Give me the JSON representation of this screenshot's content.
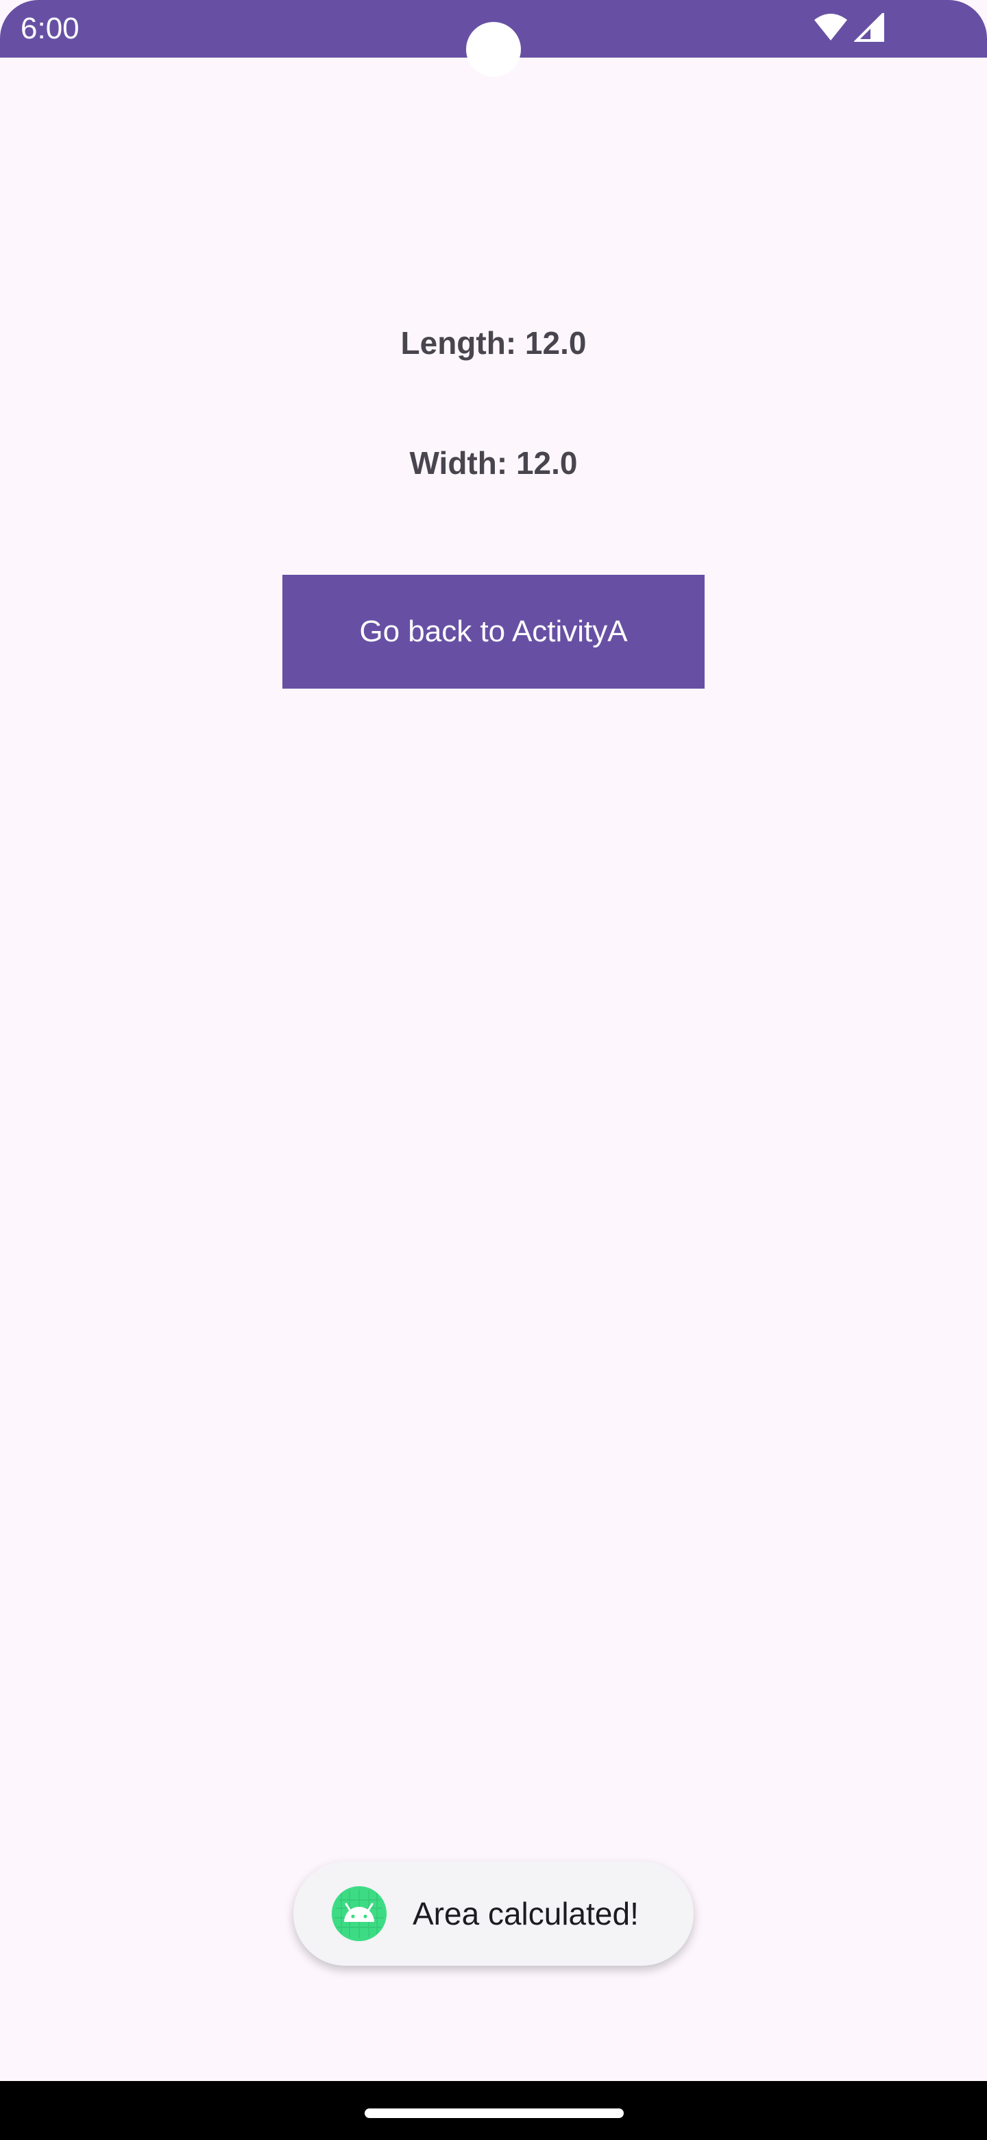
{
  "status_bar": {
    "time": "6:00",
    "color": "#6750a4",
    "icons": [
      "wifi-icon",
      "cellular-signal-icon"
    ]
  },
  "main": {
    "length_text": "Length: 12.0",
    "width_text": "Width: 12.0",
    "back_button_label": "Go back to ActivityA",
    "button_color": "#6750a4"
  },
  "toast": {
    "icon": "android-icon",
    "message": "Area calculated!"
  }
}
